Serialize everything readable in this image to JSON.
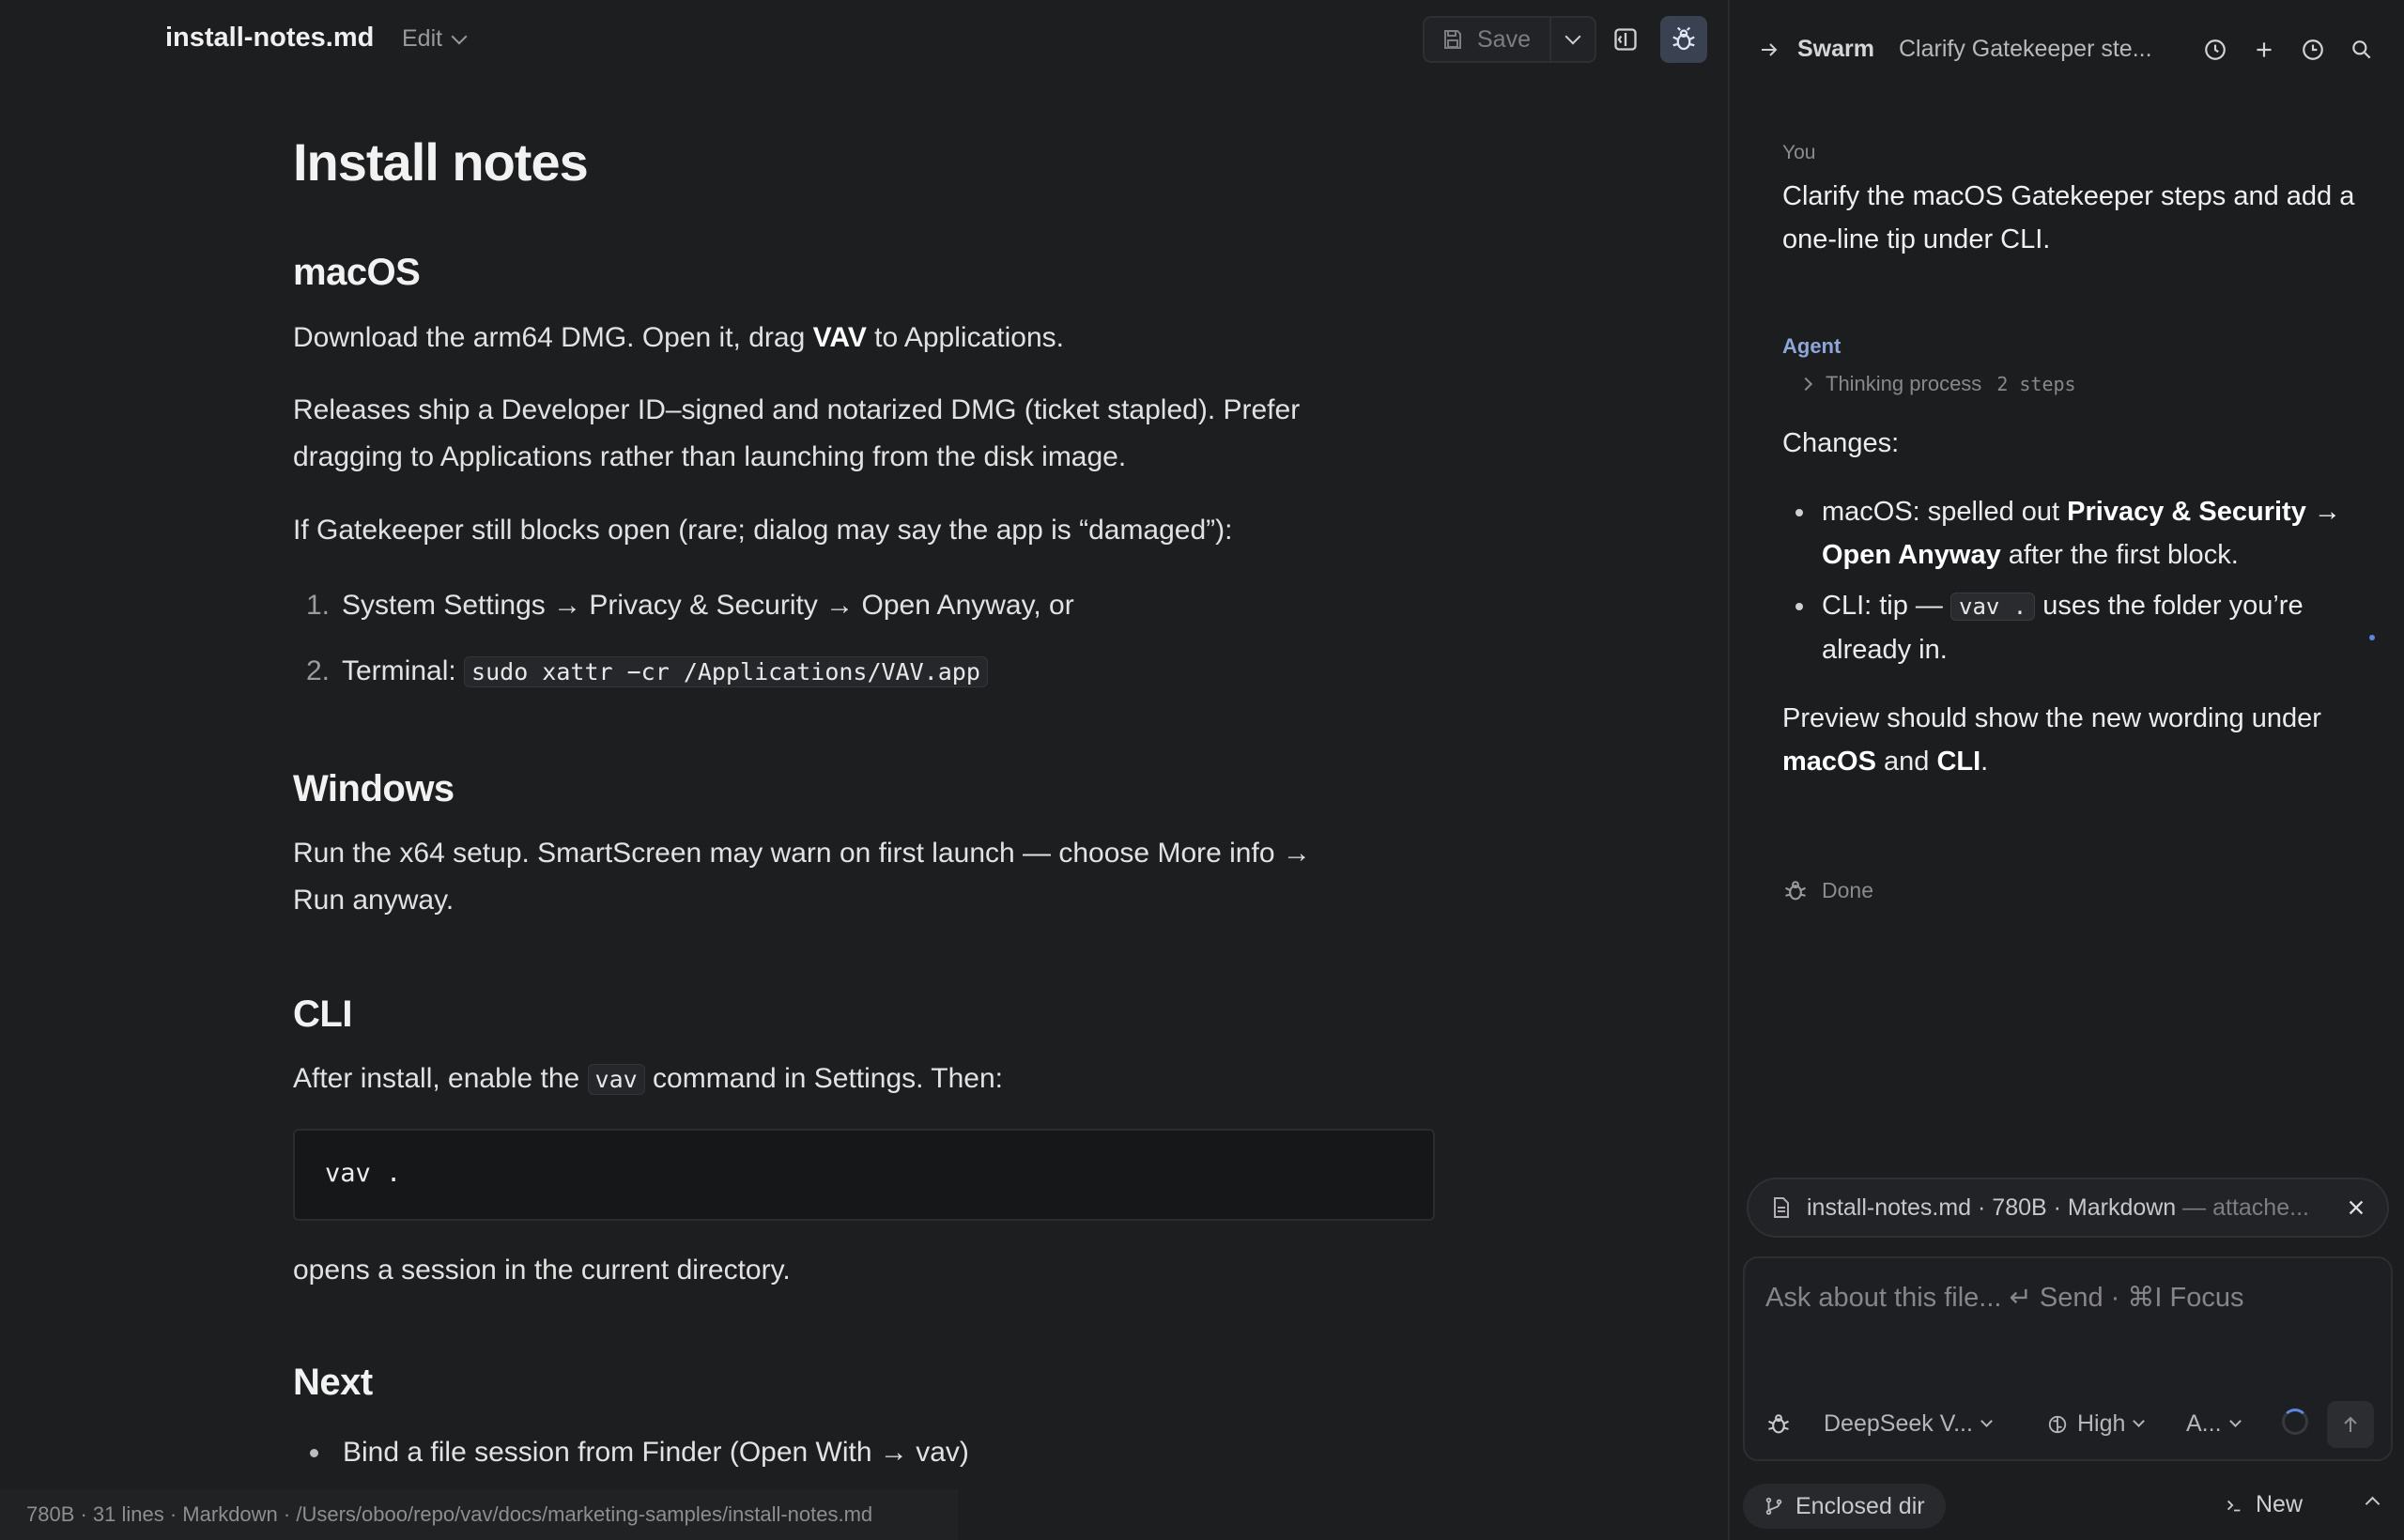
{
  "editor": {
    "filename": "install-notes.md",
    "edit_label": "Edit",
    "save_label": "Save"
  },
  "doc": {
    "title": "Install notes",
    "macos": {
      "heading": "macOS",
      "p1_a": "Download the arm64 DMG. Open it, drag ",
      "p1_bold": "VAV",
      "p1_b": " to Applications.",
      "p2": "Releases ship a Developer ID–signed and notarized DMG (ticket stapled). Prefer dragging to Applications rather than launching from the disk image.",
      "p3": "If Gatekeeper still blocks open (rare; dialog may say the app is “damaged”):",
      "steps": [
        {
          "num": "1.",
          "text": "System Settings → Privacy & Security → Open Anyway, or",
          "code": ""
        },
        {
          "num": "2.",
          "text": "Terminal: ",
          "code": "sudo xattr −cr /Applications/VAV.app"
        }
      ]
    },
    "windows": {
      "heading": "Windows",
      "p1": "Run the x64 setup. SmartScreen may warn on first launch — choose More info → Run anyway."
    },
    "cli": {
      "heading": "CLI",
      "p1_a": "After install, enable the ",
      "p1_code": "vav",
      "p1_b": " command in Settings. Then:",
      "code_block": "vav .",
      "p2": "opens a session in the current directory."
    },
    "next": {
      "heading": "Next",
      "items": [
        "Bind a file session from Finder (Open With → vav)"
      ]
    }
  },
  "statusbar": {
    "text": "780B · 31 lines · Markdown · /Users/oboo/repo/vav/docs/marketing-samples/install-notes.md"
  },
  "chat": {
    "swarm_label": "Swarm",
    "session_title": "Clarify Gatekeeper ste...",
    "you_label": "You",
    "you_message": "Clarify the macOS Gatekeeper steps and add a one-line tip under CLI.",
    "agent_label": "Agent",
    "thinking_label": "Thinking process",
    "thinking_steps": "2 steps",
    "changes_label": "Changes:",
    "change1_a": "macOS: spelled out ",
    "change1_bold": "Privacy & Security → Open Anyway",
    "change1_b": " after the first block.",
    "change2_a": "CLI: tip — ",
    "change2_code": "vav .",
    "change2_b": " uses the folder you’re already in.",
    "preview_a": "Preview should show the new wording under ",
    "preview_b1": "macOS",
    "preview_and": " and ",
    "preview_b2": "CLI",
    "preview_end": ".",
    "done_label": "Done",
    "attachment": "install-notes.md · 780B · Markdown",
    "attachment_note": " — attache...",
    "composer_placeholder": "Ask about this file... ↵ Send · ⌘I Focus",
    "model": "DeepSeek V...",
    "effort": "High",
    "mode": "A...",
    "enclosed_label": "Enclosed dir",
    "new_label": "New"
  },
  "colors": {
    "accent": "#5d86e0",
    "agent_label": "#8ea6d8",
    "background": "#1d1e20"
  }
}
